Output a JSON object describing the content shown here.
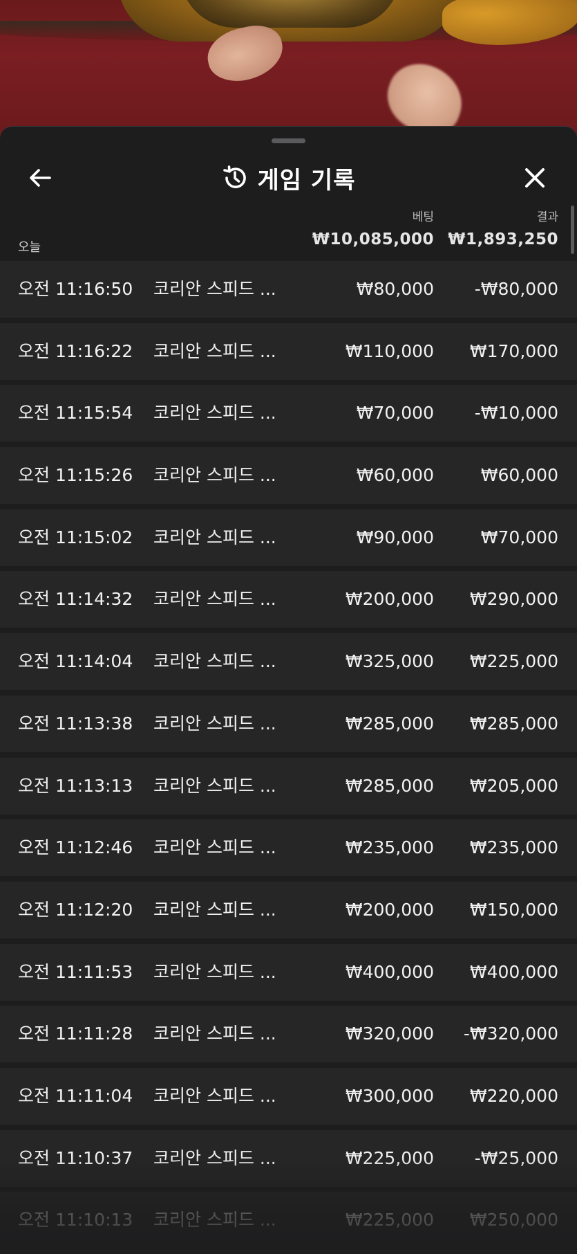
{
  "sheet": {
    "title": "게임 기록",
    "columns": {
      "bet": "베팅",
      "result": "결과"
    },
    "group_label": "오늘",
    "totals": {
      "bet": "₩10,085,000",
      "result": "₩1,893,250"
    }
  },
  "rows": [
    {
      "time": "오전 11:16:50",
      "game": "코리안 스피드 ...",
      "bet": "₩80,000",
      "result": "-₩80,000"
    },
    {
      "time": "오전 11:16:22",
      "game": "코리안 스피드 ...",
      "bet": "₩110,000",
      "result": "₩170,000"
    },
    {
      "time": "오전 11:15:54",
      "game": "코리안 스피드 ...",
      "bet": "₩70,000",
      "result": "-₩10,000"
    },
    {
      "time": "오전 11:15:26",
      "game": "코리안 스피드 ...",
      "bet": "₩60,000",
      "result": "₩60,000"
    },
    {
      "time": "오전 11:15:02",
      "game": "코리안 스피드 ...",
      "bet": "₩90,000",
      "result": "₩70,000"
    },
    {
      "time": "오전 11:14:32",
      "game": "코리안 스피드 ...",
      "bet": "₩200,000",
      "result": "₩290,000"
    },
    {
      "time": "오전 11:14:04",
      "game": "코리안 스피드 ...",
      "bet": "₩325,000",
      "result": "₩225,000"
    },
    {
      "time": "오전 11:13:38",
      "game": "코리안 스피드 ...",
      "bet": "₩285,000",
      "result": "₩285,000"
    },
    {
      "time": "오전 11:13:13",
      "game": "코리안 스피드 ...",
      "bet": "₩285,000",
      "result": "₩205,000"
    },
    {
      "time": "오전 11:12:46",
      "game": "코리안 스피드 ...",
      "bet": "₩235,000",
      "result": "₩235,000"
    },
    {
      "time": "오전 11:12:20",
      "game": "코리안 스피드 ...",
      "bet": "₩200,000",
      "result": "₩150,000"
    },
    {
      "time": "오전 11:11:53",
      "game": "코리안 스피드 ...",
      "bet": "₩400,000",
      "result": "₩400,000"
    },
    {
      "time": "오전 11:11:28",
      "game": "코리안 스피드 ...",
      "bet": "₩320,000",
      "result": "-₩320,000"
    },
    {
      "time": "오전 11:11:04",
      "game": "코리안 스피드 ...",
      "bet": "₩300,000",
      "result": "₩220,000"
    },
    {
      "time": "오전 11:10:37",
      "game": "코리안 스피드 ...",
      "bet": "₩225,000",
      "result": "-₩25,000"
    },
    {
      "time": "오전 11:10:13",
      "game": "코리안 스피드 ...",
      "bet": "₩225,000",
      "result": "₩250,000"
    }
  ],
  "icons": {
    "back": "arrow-left-icon",
    "history": "history-clock-icon",
    "close": "close-icon"
  },
  "colors": {
    "sheet_bg": "#1d1d1e",
    "row_bg": "#262627",
    "text": "#f2f2f2",
    "felt": "#7a1e22"
  }
}
